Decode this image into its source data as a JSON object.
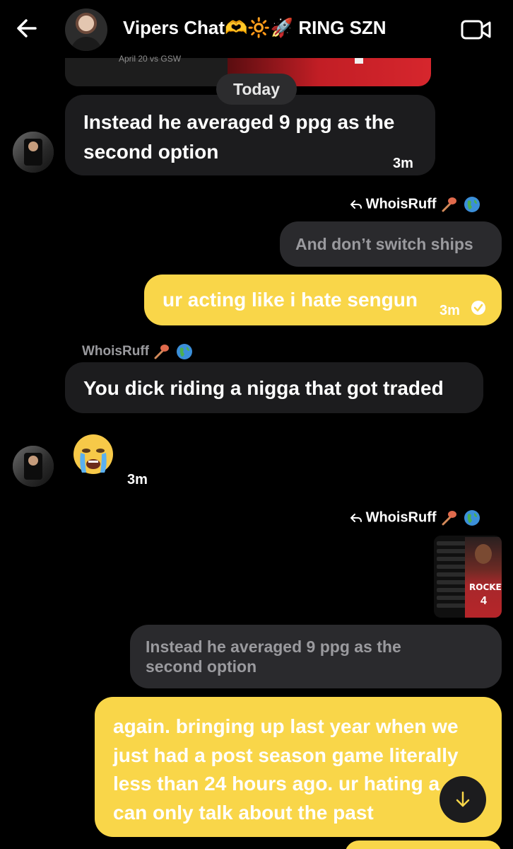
{
  "header": {
    "title": "Vipers Chat🫶🔆🚀 RING SZN",
    "back_icon": "arrow-left-icon",
    "video_icon": "video-camera-icon"
  },
  "top_media": {
    "caption": "April 20 vs GSW"
  },
  "date_separator": "Today",
  "messages": {
    "m1": {
      "text": "Instead he averaged 9 ppg as the\nsecond option",
      "time": "3m"
    },
    "m2": {
      "reply_to": "WhoisRuff",
      "quoted_text": "And don’t switch ships",
      "text": "ur acting like i hate sengun",
      "time": "3m"
    },
    "m3": {
      "sender": "WhoisRuff",
      "text": "You dick riding a nigga that got traded"
    },
    "m4": {
      "emoji": "😭",
      "time": "3m"
    },
    "m5": {
      "reply_to": "WhoisRuff",
      "quoted_text": "Instead he averaged 9 ppg as the\nsecond option",
      "text": "again. bringing up last year when we\njust had a post season game literally\nless than 24 hours ago. ur hating a\ncan only talk about the past",
      "jersey_team": "ROCKETS",
      "jersey_number": "4"
    }
  },
  "colors": {
    "background": "#000000",
    "incoming_bubble": "#1c1c1e",
    "outgoing_bubble": "#f9d649",
    "quote_bubble": "#2a2a2d"
  }
}
